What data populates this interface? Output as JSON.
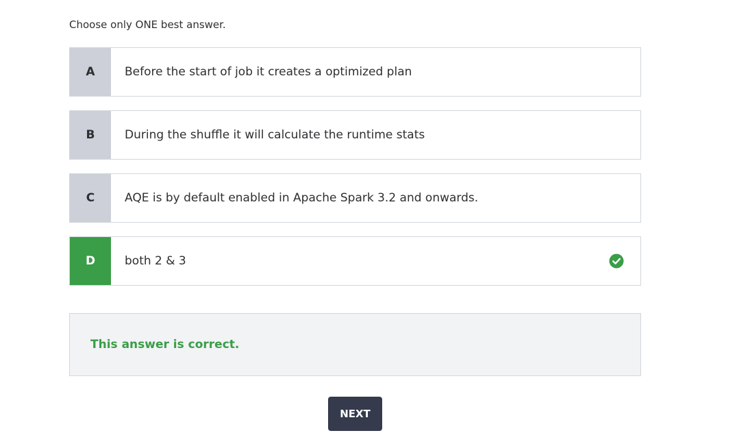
{
  "instruction": "Choose only ONE best answer.",
  "options": [
    {
      "letter": "A",
      "text": "Before the start of job it creates a optimized plan",
      "correct": false
    },
    {
      "letter": "B",
      "text": "During the shuffle it will calculate the runtime stats",
      "correct": false
    },
    {
      "letter": "C",
      "text": "AQE is by default enabled in Apache Spark 3.2 and onwards.",
      "correct": false
    },
    {
      "letter": "D",
      "text": "both 2 & 3",
      "correct": true
    }
  ],
  "feedback": {
    "message": "This answer is correct."
  },
  "next_button": {
    "label": "NEXT"
  },
  "colors": {
    "correct_green": "#3a9d48",
    "letter_gray": "#cdd0d8",
    "button_dark": "#363a4d",
    "feedback_bg": "#f2f3f5"
  },
  "icons": {
    "correct_indicator": "check-circle-icon"
  }
}
